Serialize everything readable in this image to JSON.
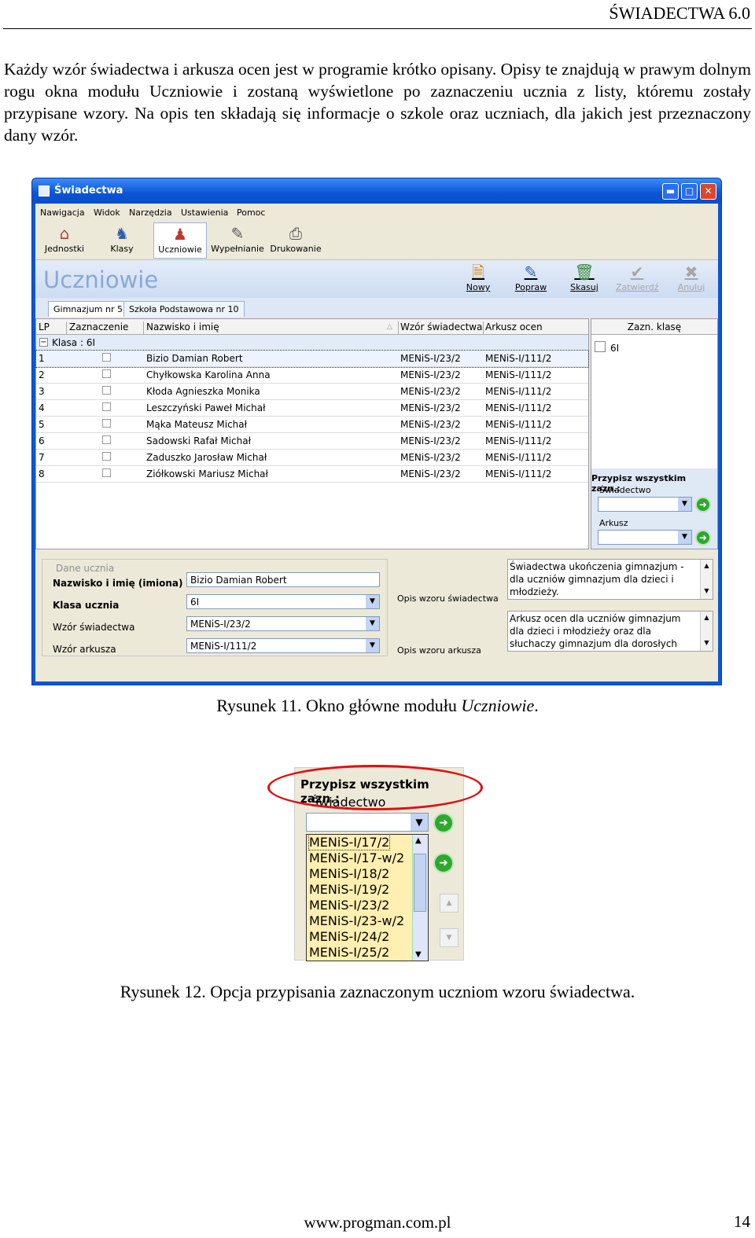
{
  "header": {
    "title": "ŚWIADECTWA 6.0"
  },
  "intro": "Każdy wzór świadectwa i arkusza ocen jest w programie krótko opisany. Opisy te znajdują w prawym dolnym rogu okna modułu Uczniowie i zostaną wyświetlone po zaznaczeniu ucznia z listy, któremu zostały przypisane wzory. Na opis ten składają się informacje o szkole oraz uczniach, dla jakich jest przeznaczony dany wzór.",
  "window": {
    "title": "Świadectwa",
    "menu": [
      "Nawigacja",
      "Widok",
      "Narzędzia",
      "Ustawienia",
      "Pomoc"
    ],
    "toolbar": [
      "Jednostki",
      "Klasy",
      "Uczniowie",
      "Wypełnianie",
      "Drukowanie"
    ],
    "section_title": "Uczniowie",
    "actions": [
      "Nowy",
      "Popraw",
      "Skasuj",
      "Zatwierdź",
      "Anuluj"
    ],
    "tabs": [
      "Gimnazjum nr 5",
      "Szkoła Podstawowa nr 10"
    ],
    "columns": [
      "LP",
      "Zaznaczenie",
      "Nazwisko i imię",
      "Wzór świadectwa",
      "Arkusz ocen"
    ],
    "group": "Klasa : 6I",
    "rows": [
      {
        "lp": "1",
        "name": "Bizio Damian Robert",
        "wzor": "MENiS-I/23/2",
        "arkusz": "MENiS-I/111/2"
      },
      {
        "lp": "2",
        "name": "Chyłkowska Karolina Anna",
        "wzor": "MENiS-I/23/2",
        "arkusz": "MENiS-I/111/2"
      },
      {
        "lp": "3",
        "name": "Kłoda Agnieszka Monika",
        "wzor": "MENiS-I/23/2",
        "arkusz": "MENiS-I/111/2"
      },
      {
        "lp": "4",
        "name": "Leszczyński Paweł Michał",
        "wzor": "MENiS-I/23/2",
        "arkusz": "MENiS-I/111/2"
      },
      {
        "lp": "5",
        "name": "Mąka Mateusz Michał",
        "wzor": "MENiS-I/23/2",
        "arkusz": "MENiS-I/111/2"
      },
      {
        "lp": "6",
        "name": "Sadowski Rafał Michał",
        "wzor": "MENiS-I/23/2",
        "arkusz": "MENiS-I/111/2"
      },
      {
        "lp": "7",
        "name": "Zaduszko Jarosław Michał",
        "wzor": "MENiS-I/23/2",
        "arkusz": "MENiS-I/111/2"
      },
      {
        "lp": "8",
        "name": "Ziółkowski Mariusz Michał",
        "wzor": "MENiS-I/23/2",
        "arkusz": "MENiS-I/111/2"
      }
    ],
    "right_panel": {
      "header": "Zazn. klasę",
      "class": "6I",
      "assign_title": "Przypisz wszystkim zazn.:",
      "swiadectwo_label": "Świadectwo",
      "arkusz_label": "Arkusz"
    },
    "details": {
      "caption": "Dane ucznia",
      "name_label": "Nazwisko i imię (imiona)",
      "name_value": "Bizio Damian Robert",
      "class_label": "Klasa ucznia",
      "class_value": "6I",
      "wzor_label": "Wzór świadectwa",
      "wzor_value": "MENiS-I/23/2",
      "arkusz_label": "Wzór arkusza",
      "arkusz_value": "MENiS-I/111/2",
      "opis_swiadectwa_label": "Opis wzoru świadectwa",
      "opis_swiadectwa": "Świadectwa ukończenia gimnazjum - dla uczniów gimnazjum dla dzieci i młodzieży.",
      "opis_arkusza_label": "Opis wzoru arkusza",
      "opis_arkusza": "Arkusz ocen dla uczniów gimnazjum dla dzieci i młodzieży oraz dla słuchaczy gimnazjum dla dorosłych prowadzonego"
    }
  },
  "caption11": {
    "prefix": "Rysunek 11. Okno główne modułu ",
    "em": "Uczniowie",
    "suffix": "."
  },
  "fig12": {
    "title": "Przypisz wszystkim zazn.:",
    "sub": "Świadectwo",
    "items": [
      "MENiS-I/17/2",
      "MENiS-I/17-w/2",
      "MENiS-I/18/2",
      "MENiS-I/19/2",
      "MENiS-I/23/2",
      "MENiS-I/23-w/2",
      "MENiS-I/24/2",
      "MENiS-I/25/2"
    ]
  },
  "caption12": "Rysunek 12. Opcja przypisania zaznaczonym uczniom wzoru świadectwa.",
  "footer": {
    "url": "www.progman.com.pl",
    "page": "14"
  }
}
